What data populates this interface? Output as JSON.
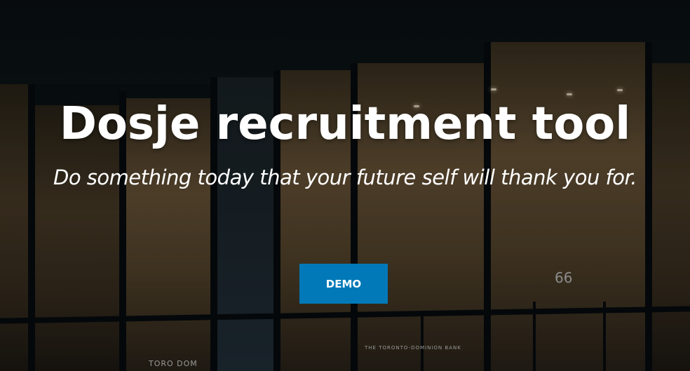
{
  "hero": {
    "title": "Dosje recruitment tool",
    "subtitle": "Do something today that your future self will thank you for.",
    "demo_button": "DEMO"
  },
  "background": {
    "building_number": "66",
    "sign_left": "TORO    DOM",
    "sign_center": "THE TORONTO-DOMINION BANK"
  },
  "colors": {
    "accent": "#0179b8"
  }
}
